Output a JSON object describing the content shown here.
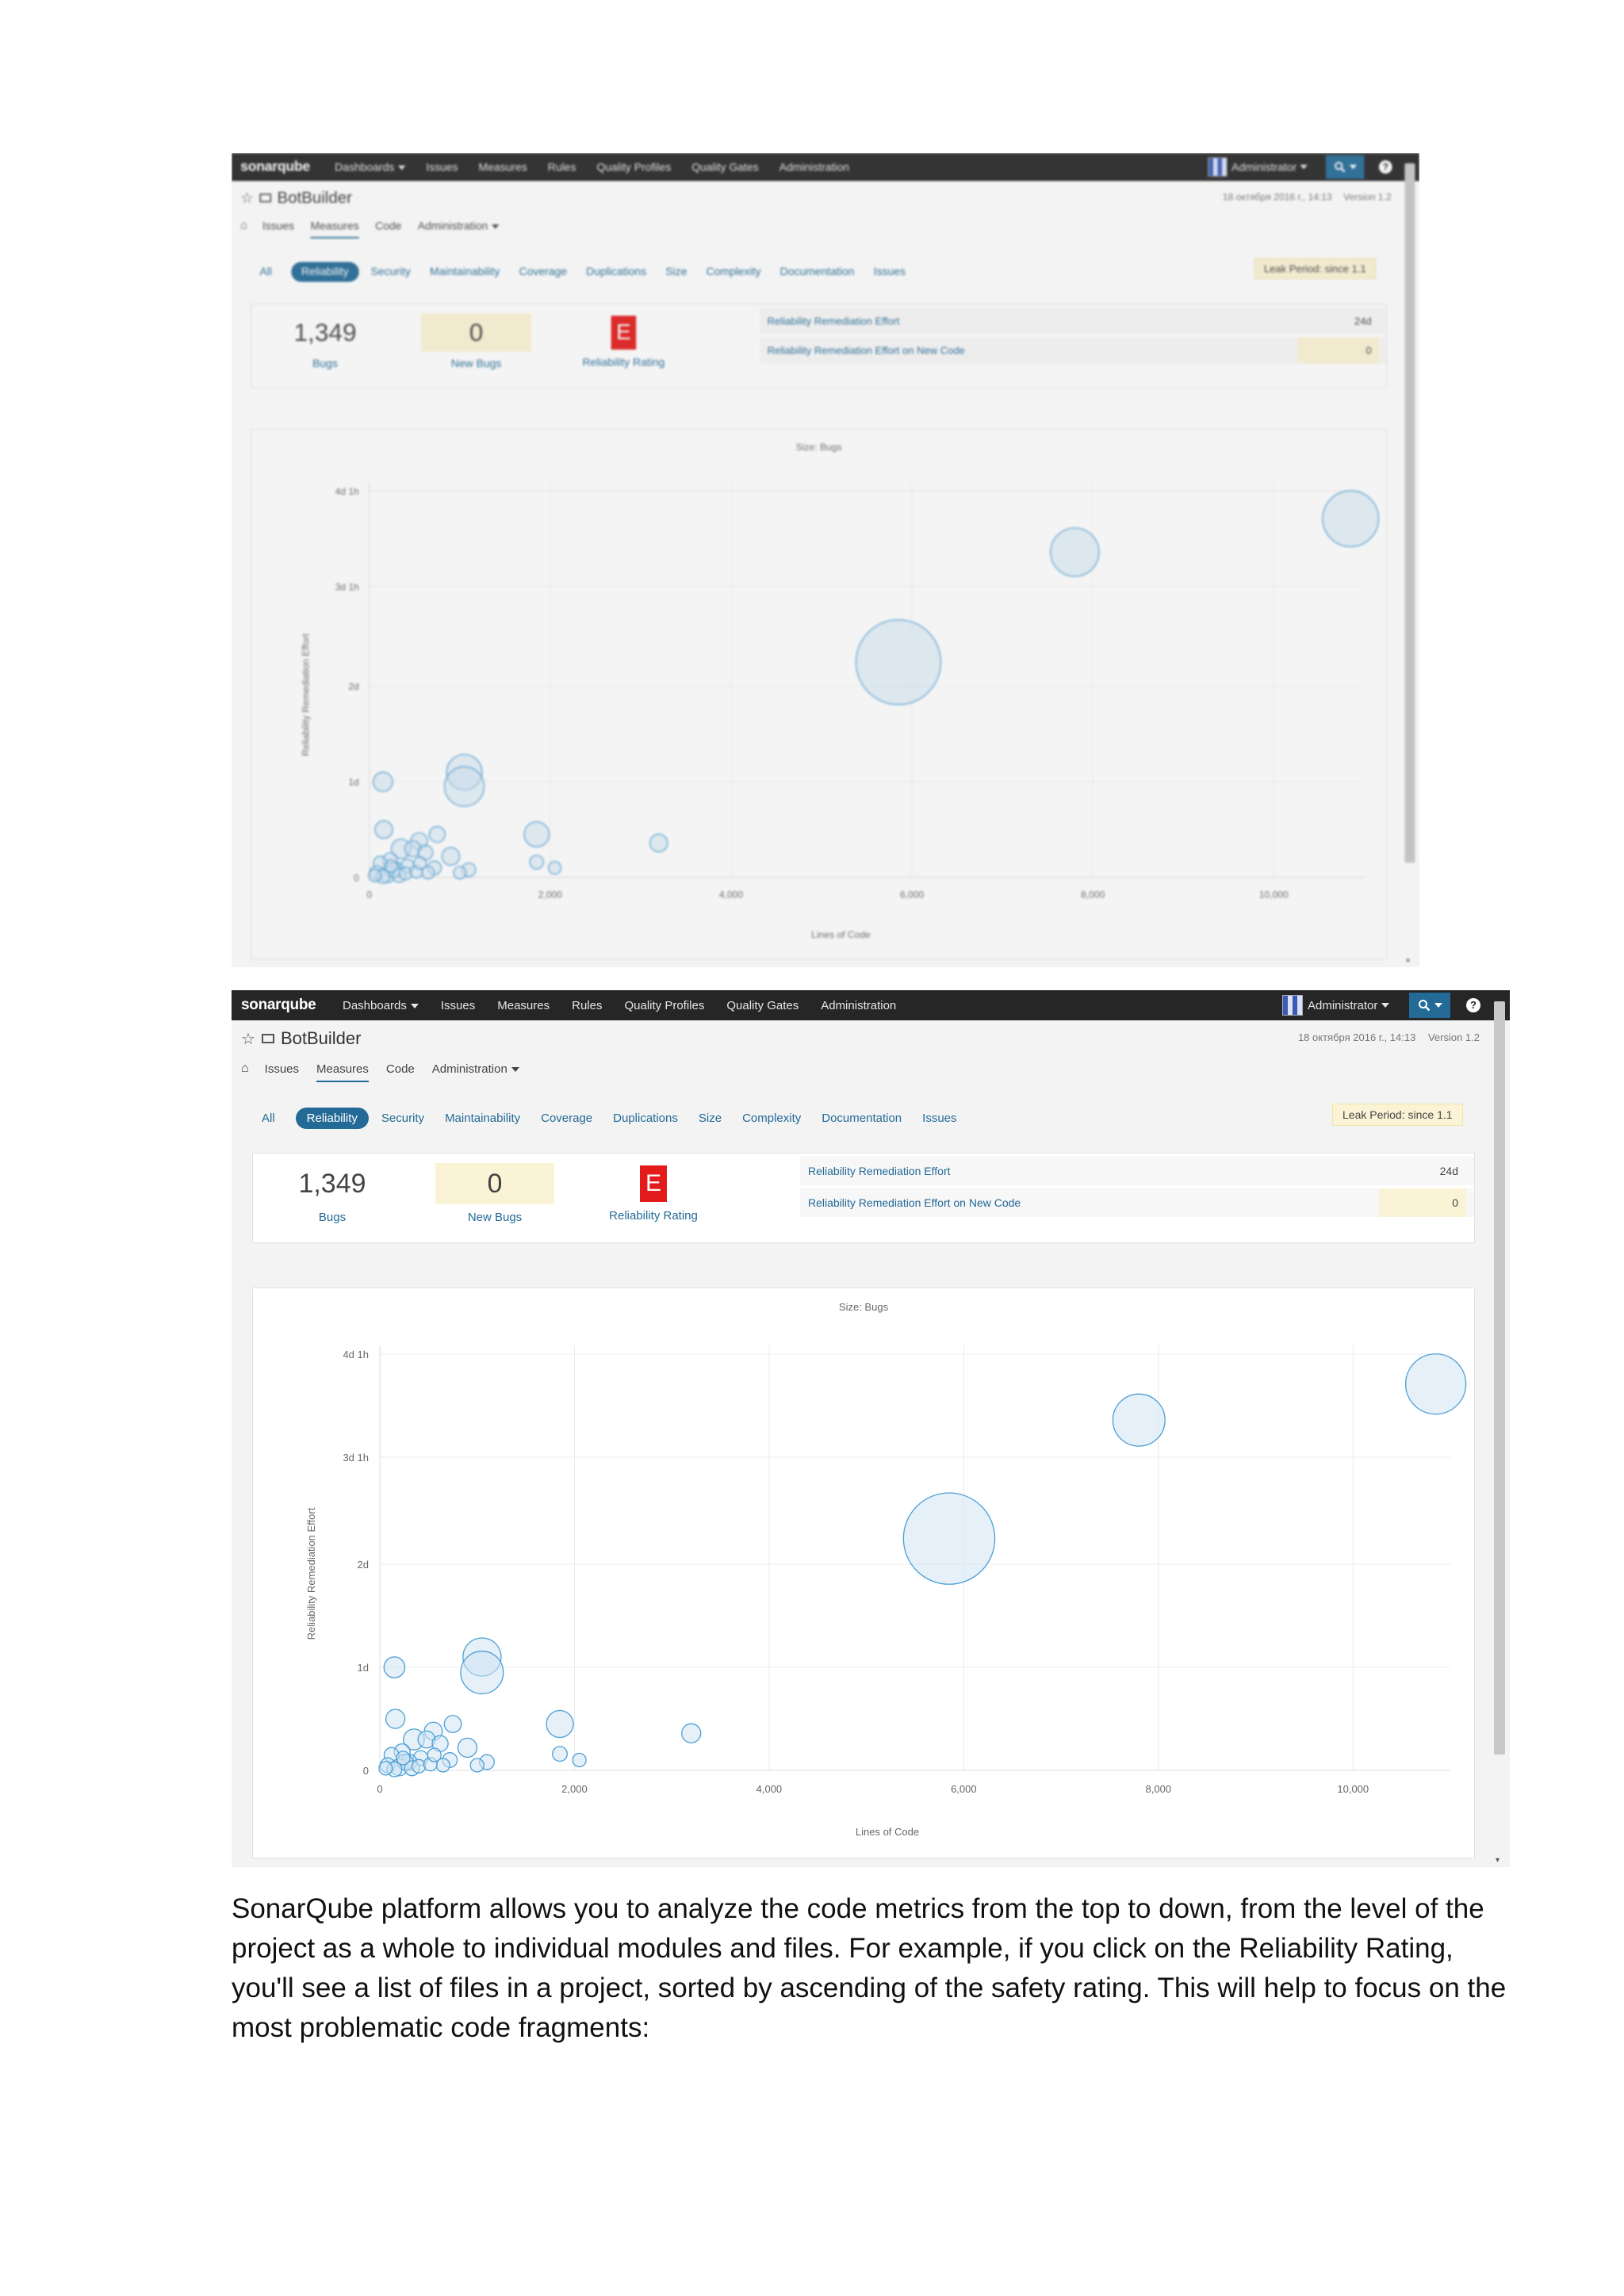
{
  "app": {
    "logo": "sonarqube",
    "nav": [
      "Dashboards",
      "Issues",
      "Measures",
      "Rules",
      "Quality Profiles",
      "Quality Gates",
      "Administration"
    ],
    "user": "Administrator"
  },
  "project": {
    "name": "BotBuilder",
    "date": "18 октября 2016 г., 14:13",
    "version": "Version 1.2",
    "subnav": [
      "Issues",
      "Measures",
      "Code",
      "Administration"
    ]
  },
  "domains": [
    "All",
    "Reliability",
    "Security",
    "Maintainability",
    "Coverage",
    "Duplications",
    "Size",
    "Complexity",
    "Documentation",
    "Issues"
  ],
  "leak_period": "Leak Period: since 1.1",
  "summary": {
    "bugs_value": "1,349",
    "bugs_label": "Bugs",
    "new_bugs_value": "0",
    "new_bugs_label": "New Bugs",
    "rating_value": "E",
    "rating_label": "Reliability Rating",
    "effort_label": "Reliability Remediation Effort",
    "effort_value": "24d",
    "new_effort_label": "Reliability Remediation Effort on New Code",
    "new_effort_value": "0"
  },
  "colors": {
    "accent": "#236a97",
    "rating_e": "#e31b1b",
    "leak_bg": "#fbf3d5",
    "bubble_fill": "#cfe4f3",
    "bubble_stroke": "#4b9fd5"
  },
  "chart_data": {
    "type": "scatter",
    "title": "Size: Bugs",
    "xlabel": "Lines of Code",
    "ylabel": "Reliability Remediation Effort",
    "xlim": [
      0,
      11000
    ],
    "ylim_days": [
      0,
      4.125
    ],
    "x_ticks": [
      "0",
      "2,000",
      "4,000",
      "6,000",
      "8,000",
      "10,000"
    ],
    "y_ticks": [
      "0",
      "1d",
      "2d",
      "3d 1h",
      "4d 1h"
    ],
    "points": [
      {
        "x": 10850,
        "y": 3.75,
        "bugs": 100
      },
      {
        "x": 7800,
        "y": 3.4,
        "bugs": 75
      },
      {
        "x": 5850,
        "y": 2.25,
        "bugs": 230
      },
      {
        "x": 1050,
        "y": 1.1,
        "bugs": 40
      },
      {
        "x": 1050,
        "y": 0.95,
        "bugs": 50
      },
      {
        "x": 150,
        "y": 1.0,
        "bugs": 12
      },
      {
        "x": 1850,
        "y": 0.45,
        "bugs": 20
      },
      {
        "x": 3200,
        "y": 0.36,
        "bugs": 10
      },
      {
        "x": 160,
        "y": 0.5,
        "bugs": 10
      },
      {
        "x": 750,
        "y": 0.45,
        "bugs": 8
      },
      {
        "x": 900,
        "y": 0.22,
        "bugs": 10
      },
      {
        "x": 1850,
        "y": 0.16,
        "bugs": 6
      },
      {
        "x": 2050,
        "y": 0.1,
        "bugs": 5
      },
      {
        "x": 350,
        "y": 0.3,
        "bugs": 12
      },
      {
        "x": 550,
        "y": 0.38,
        "bugs": 9
      },
      {
        "x": 480,
        "y": 0.3,
        "bugs": 8
      },
      {
        "x": 620,
        "y": 0.26,
        "bugs": 7
      },
      {
        "x": 230,
        "y": 0.18,
        "bugs": 7
      },
      {
        "x": 720,
        "y": 0.1,
        "bugs": 6
      },
      {
        "x": 1100,
        "y": 0.08,
        "bugs": 6
      },
      {
        "x": 1000,
        "y": 0.05,
        "bugs": 5
      },
      {
        "x": 650,
        "y": 0.05,
        "bugs": 5
      },
      {
        "x": 420,
        "y": 0.12,
        "bugs": 6
      },
      {
        "x": 300,
        "y": 0.08,
        "bugs": 7
      },
      {
        "x": 120,
        "y": 0.15,
        "bugs": 6
      },
      {
        "x": 80,
        "y": 0.05,
        "bugs": 6
      },
      {
        "x": 200,
        "y": 0.03,
        "bugs": 8
      },
      {
        "x": 260,
        "y": 0.08,
        "bugs": 7
      },
      {
        "x": 330,
        "y": 0.02,
        "bugs": 6
      },
      {
        "x": 400,
        "y": 0.04,
        "bugs": 5
      },
      {
        "x": 520,
        "y": 0.06,
        "bugs": 5
      },
      {
        "x": 150,
        "y": 0.01,
        "bugs": 6
      },
      {
        "x": 60,
        "y": 0.02,
        "bugs": 5
      },
      {
        "x": 240,
        "y": 0.12,
        "bugs": 5
      },
      {
        "x": 560,
        "y": 0.15,
        "bugs": 5
      }
    ]
  },
  "caption": "SonarQube platform allows you to analyze the code metrics from the top to down, from the level of the project as a whole to individual modules and files. For example, if you click on the Reliability Rating, you'll see a list of files in a project, sorted by ascending of the safety rating. This will help to focus on the most problematic code fragments:"
}
